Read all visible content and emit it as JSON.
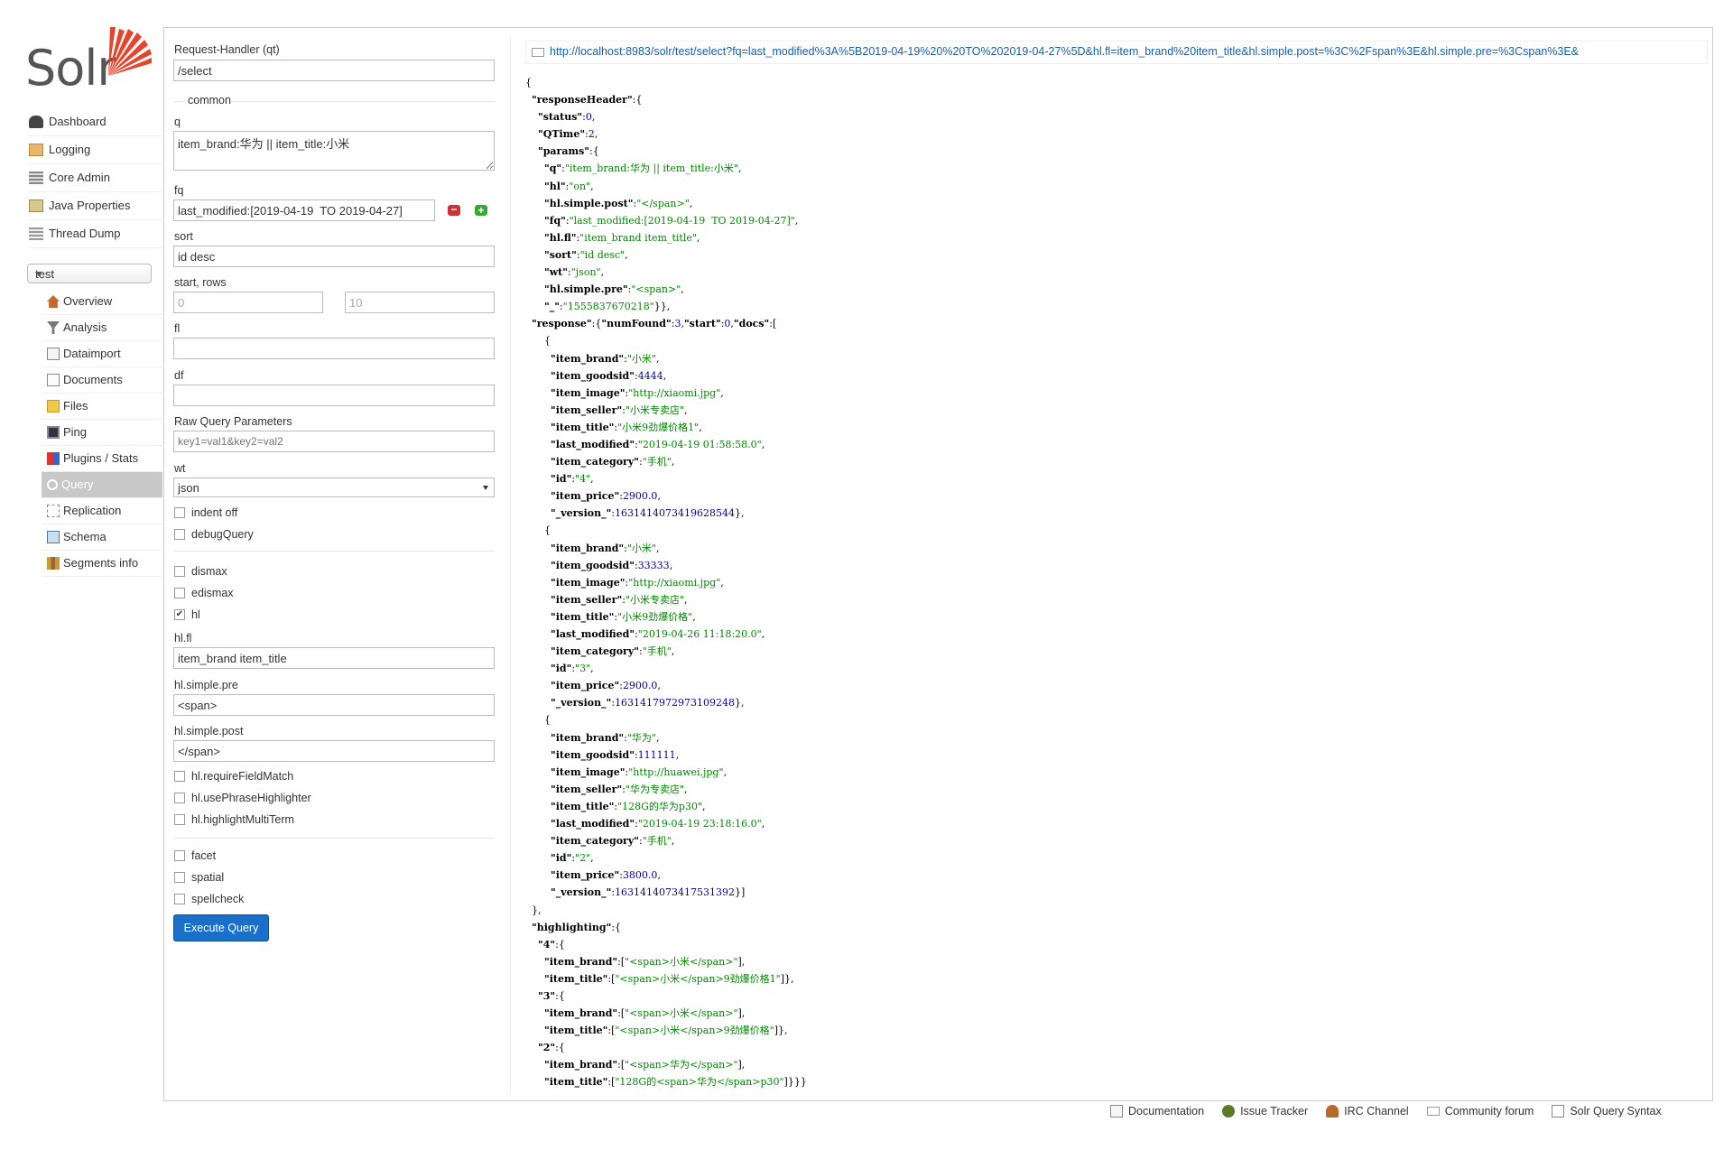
{
  "logo": {
    "text": "Solr"
  },
  "nav": [
    {
      "label": "Dashboard",
      "icon": "dashboard-icon"
    },
    {
      "label": "Logging",
      "icon": "logging-icon"
    },
    {
      "label": "Core Admin",
      "icon": "core-admin-icon"
    },
    {
      "label": "Java Properties",
      "icon": "java-properties-icon"
    },
    {
      "label": "Thread Dump",
      "icon": "thread-dump-icon"
    }
  ],
  "core_selector": {
    "value": "test"
  },
  "core_nav": [
    {
      "label": "Overview",
      "icon": "overview-icon"
    },
    {
      "label": "Analysis",
      "icon": "analysis-icon"
    },
    {
      "label": "Dataimport",
      "icon": "dataimport-icon"
    },
    {
      "label": "Documents",
      "icon": "documents-icon"
    },
    {
      "label": "Files",
      "icon": "files-icon"
    },
    {
      "label": "Ping",
      "icon": "ping-icon"
    },
    {
      "label": "Plugins / Stats",
      "icon": "plugins-icon"
    },
    {
      "label": "Query",
      "icon": "query-icon",
      "active": true
    },
    {
      "label": "Replication",
      "icon": "replication-icon"
    },
    {
      "label": "Schema",
      "icon": "schema-icon"
    },
    {
      "label": "Segments info",
      "icon": "segments-icon"
    }
  ],
  "form": {
    "request_handler_label": "Request-Handler (qt)",
    "request_handler_value": "/select",
    "common_legend": "common",
    "q_label": "q",
    "q_value": "item_brand:华为 || item_title:小米",
    "fq_label": "fq",
    "fq_value": "last_modified:[2019-04-19  TO 2019-04-27]",
    "sort_label": "sort",
    "sort_value": "id desc",
    "start_rows_label": "start, rows",
    "start_value": "0",
    "rows_value": "10",
    "fl_label": "fl",
    "fl_value": "",
    "df_label": "df",
    "df_value": "",
    "raw_label": "Raw Query Parameters",
    "raw_placeholder": "key1=val1&key2=val2",
    "wt_label": "wt",
    "wt_value": "json",
    "indent_label": "indent off",
    "debug_label": "debugQuery",
    "dismax_label": "dismax",
    "edismax_label": "edismax",
    "hl_label": "hl",
    "hl_checked": true,
    "hlfl_label": "hl.fl",
    "hlfl_value": "item_brand item_title",
    "hlpre_label": "hl.simple.pre",
    "hlpre_value": "<span>",
    "hlpost_label": "hl.simple.post",
    "hlpost_value": "</span>",
    "require_label": "hl.requireFieldMatch",
    "phrase_label": "hl.usePhraseHighlighter",
    "multiterm_label": "hl.highlightMultiTerm",
    "facet_label": "facet",
    "spatial_label": "spatial",
    "spellcheck_label": "spellcheck",
    "execute_label": "Execute Query"
  },
  "result": {
    "url": "http://localhost:8983/solr/test/select?fq=last_modified%3A%5B2019-04-19%20%20TO%202019-04-27%5D&hl.fl=item_brand%20item_title&hl.simple.post=%3C%2Fspan%3E&hl.simple.pre=%3Cspan%3E&",
    "json_lines": [
      "{",
      "  \"responseHeader\":{",
      "    \"status\":0,",
      "    \"QTime\":2,",
      "    \"params\":{",
      "      \"q\":\"item_brand:华为 || item_title:小米\",",
      "      \"hl\":\"on\",",
      "      \"hl.simple.post\":\"</span>\",",
      "      \"fq\":\"last_modified:[2019-04-19  TO 2019-04-27]\",",
      "      \"hl.fl\":\"item_brand item_title\",",
      "      \"sort\":\"id desc\",",
      "      \"wt\":\"json\",",
      "      \"hl.simple.pre\":\"<span>\",",
      "      \"_\":\"1555837670218\"}},",
      "  \"response\":{\"numFound\":3,\"start\":0,\"docs\":[",
      "      {",
      "        \"item_brand\":\"小米\",",
      "        \"item_goodsid\":4444,",
      "        \"item_image\":\"http://xiaomi.jpg\",",
      "        \"item_seller\":\"小米专卖店\",",
      "        \"item_title\":\"小米9劲爆价格1\",",
      "        \"last_modified\":\"2019-04-19 01:58:58.0\",",
      "        \"item_category\":\"手机\",",
      "        \"id\":\"4\",",
      "        \"item_price\":2900.0,",
      "        \"_version_\":1631414073419628544},",
      "      {",
      "        \"item_brand\":\"小米\",",
      "        \"item_goodsid\":33333,",
      "        \"item_image\":\"http://xiaomi.jpg\",",
      "        \"item_seller\":\"小米专卖店\",",
      "        \"item_title\":\"小米9劲爆价格\",",
      "        \"last_modified\":\"2019-04-26 11:18:20.0\",",
      "        \"item_category\":\"手机\",",
      "        \"id\":\"3\",",
      "        \"item_price\":2900.0,",
      "        \"_version_\":1631417972973109248},",
      "      {",
      "        \"item_brand\":\"华为\",",
      "        \"item_goodsid\":111111,",
      "        \"item_image\":\"http://huawei.jpg\",",
      "        \"item_seller\":\"华为专卖店\",",
      "        \"item_title\":\"128G的华为p30\",",
      "        \"last_modified\":\"2019-04-19 23:18:16.0\",",
      "        \"item_category\":\"手机\",",
      "        \"id\":\"2\",",
      "        \"item_price\":3800.0,",
      "        \"_version_\":1631414073417531392}]",
      "  },",
      "  \"highlighting\":{",
      "    \"4\":{",
      "      \"item_brand\":[\"<span>小米</span>\"],",
      "      \"item_title\":[\"<span>小米</span>9劲爆价格1\"]},",
      "    \"3\":{",
      "      \"item_brand\":[\"<span>小米</span>\"],",
      "      \"item_title\":[\"<span>小米</span>9劲爆价格\"]},",
      "    \"2\":{",
      "      \"item_brand\":[\"<span>华为</span>\"],",
      "      \"item_title\":[\"128G的<span>华为</span>p30\"]}}}"
    ]
  },
  "footer": [
    {
      "label": "Documentation",
      "icon": "documentation-icon"
    },
    {
      "label": "Issue Tracker",
      "icon": "issue-tracker-icon"
    },
    {
      "label": "IRC Channel",
      "icon": "irc-channel-icon"
    },
    {
      "label": "Community forum",
      "icon": "community-forum-icon"
    },
    {
      "label": "Solr Query Syntax",
      "icon": "query-syntax-icon"
    }
  ],
  "colors": {
    "accent": "#1a6fc9",
    "logo_red": "#e5452d",
    "json_string": "#008800",
    "json_number": "#0000aa"
  }
}
